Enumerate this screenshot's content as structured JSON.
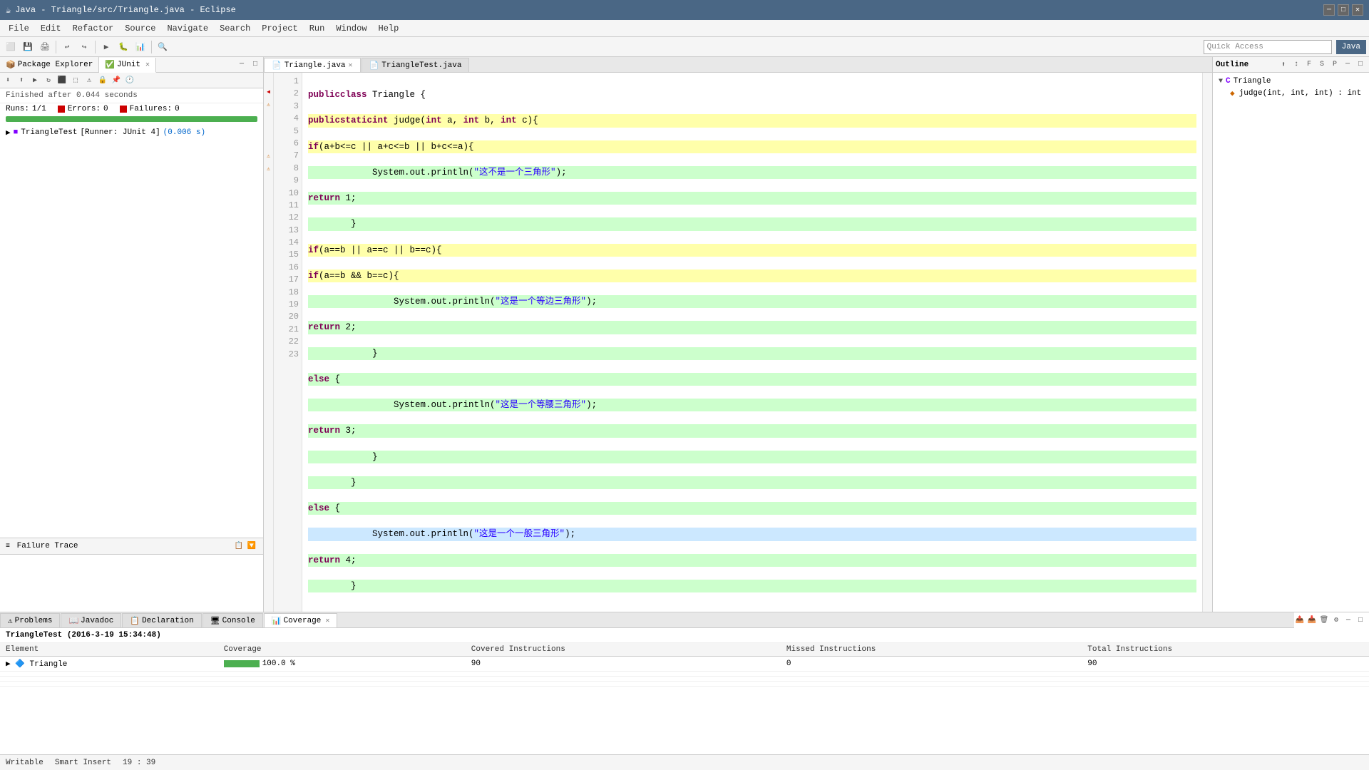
{
  "titleBar": {
    "title": "Java - Triangle/src/Triangle.java - Eclipse",
    "icon": "☕"
  },
  "menuBar": {
    "items": [
      "File",
      "Edit",
      "Refactor",
      "Source",
      "Navigate",
      "Search",
      "Project",
      "Run",
      "Window",
      "Help"
    ]
  },
  "quickAccess": {
    "placeholder": "Quick Access"
  },
  "perspective": {
    "label": "Java"
  },
  "leftPanel": {
    "tabs": [
      {
        "label": "Package Explorer",
        "icon": "📦",
        "active": false
      },
      {
        "label": "JUnit",
        "icon": "✅",
        "active": true,
        "closeable": true
      }
    ],
    "junit": {
      "status": "Finished after 0.044 seconds",
      "runs_label": "Runs:",
      "runs_value": "1/1",
      "errors_label": "Errors:",
      "errors_value": "0",
      "failures_label": "Failures:",
      "failures_value": "0",
      "progress": 100,
      "testItem": {
        "name": "TriangleTest",
        "runner": "[Runner: JUnit 4]",
        "time": "(0.006 s)"
      }
    },
    "failureTrace": {
      "label": "Failure Trace"
    }
  },
  "editor": {
    "tabs": [
      {
        "label": "Triangle.java",
        "icon": "📄",
        "active": true
      },
      {
        "label": "TriangleTest.java",
        "icon": "📄",
        "active": false
      }
    ],
    "code": {
      "lines": [
        {
          "num": 1,
          "text": "public class Triangle {",
          "style": "normal"
        },
        {
          "num": 2,
          "text": "    public static int judge(int a, int b, int c){",
          "style": "highlighted"
        },
        {
          "num": 3,
          "text": "        if(a+b<=c || a+c<=b || b+c<=a){",
          "style": "highlighted"
        },
        {
          "num": 4,
          "text": "            System.out.println(\"这不是一个三角形\");",
          "style": "covered"
        },
        {
          "num": 5,
          "text": "            return 1;",
          "style": "covered"
        },
        {
          "num": 6,
          "text": "        }",
          "style": "covered"
        },
        {
          "num": 7,
          "text": "        if(a==b || a==c || b==c){",
          "style": "highlighted"
        },
        {
          "num": 8,
          "text": "            if(a==b && b==c){",
          "style": "highlighted"
        },
        {
          "num": 9,
          "text": "                System.out.println(\"这是一个等边三角形\");",
          "style": "covered"
        },
        {
          "num": 10,
          "text": "                return 2;",
          "style": "covered"
        },
        {
          "num": 11,
          "text": "            }",
          "style": "covered"
        },
        {
          "num": 12,
          "text": "            else {",
          "style": "covered"
        },
        {
          "num": 13,
          "text": "                System.out.println(\"这是一个等腰三角形\");",
          "style": "covered"
        },
        {
          "num": 14,
          "text": "                return 3;",
          "style": "covered"
        },
        {
          "num": 15,
          "text": "            }",
          "style": "covered"
        },
        {
          "num": 16,
          "text": "        }",
          "style": "covered"
        },
        {
          "num": 17,
          "text": "        else {",
          "style": "covered"
        },
        {
          "num": 18,
          "text": "            System.out.println(\"这是一个一般三角形\");",
          "style": "selected"
        },
        {
          "num": 19,
          "text": "            return 4;",
          "style": "covered"
        },
        {
          "num": 20,
          "text": "        }",
          "style": "covered"
        },
        {
          "num": 21,
          "text": "",
          "style": "normal"
        },
        {
          "num": 22,
          "text": "    }",
          "style": "normal"
        },
        {
          "num": 23,
          "text": "}",
          "style": "normal"
        }
      ]
    }
  },
  "outline": {
    "title": "Outline",
    "tree": {
      "class": "Triangle",
      "methods": [
        {
          "label": "judge(int, int, int) : int"
        }
      ]
    }
  },
  "bottomPanel": {
    "tabs": [
      {
        "label": "Problems",
        "icon": "⚠"
      },
      {
        "label": "Javadoc",
        "icon": "📖"
      },
      {
        "label": "Declaration",
        "icon": "📋"
      },
      {
        "label": "Console",
        "icon": "🖥"
      },
      {
        "label": "Coverage",
        "icon": "📊",
        "active": true,
        "closeable": true
      }
    ],
    "coverage": {
      "title": "TriangleTest (2016-3-19 15:34:48)",
      "columns": [
        "Element",
        "Coverage",
        "Covered Instructions",
        "Missed Instructions",
        "Total Instructions"
      ],
      "rows": [
        {
          "element": "Triangle",
          "coverage_pct": "100.0 %",
          "coverage_bar": 100,
          "covered": "90",
          "missed": "0",
          "total": "90"
        }
      ]
    }
  },
  "statusBar": {
    "writable": "Writable",
    "smartInsert": "Smart Insert",
    "position": "19 : 39"
  }
}
